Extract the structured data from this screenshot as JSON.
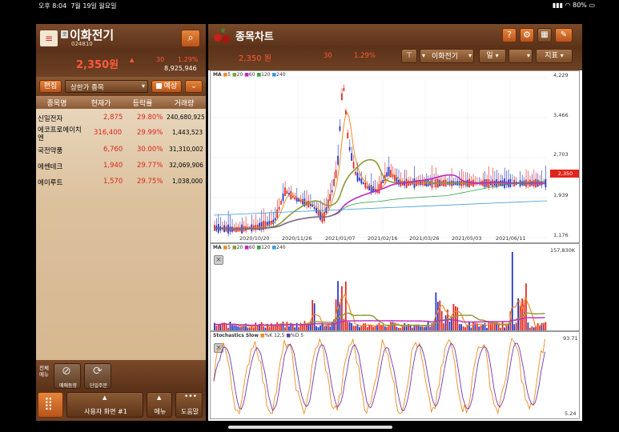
{
  "status": {
    "time": "오후 8:04",
    "date": "7월 19일 월요일",
    "battery": "80%"
  },
  "left": {
    "stock_name": "이화전기",
    "stock_code": "024810",
    "price": "2,350원",
    "change": "30",
    "change_pct": "1.29%",
    "volume": "8,925,946",
    "edit_label": "편집",
    "list_selector": "상한가 종목",
    "predict_label": "예상",
    "columns": [
      "종목명",
      "현재가",
      "등락률",
      "거래량"
    ],
    "rows": [
      {
        "name": "신일전자",
        "price": "2,875",
        "pct": "29.80%",
        "vol": "240,680,925"
      },
      {
        "name": "에코프로에이치엔",
        "price": "316,400",
        "pct": "29.99%",
        "vol": "1,443,523"
      },
      {
        "name": "국전약품",
        "price": "6,760",
        "pct": "30.00%",
        "vol": "31,310,002"
      },
      {
        "name": "에쎈테크",
        "price": "1,940",
        "pct": "29.77%",
        "vol": "32,069,906"
      },
      {
        "name": "에이루트",
        "price": "1,570",
        "pct": "29.75%",
        "vol": "1,038,000"
      }
    ],
    "footer": {
      "menu_toggle": "전체메뉴",
      "trend_btn": "매매동향",
      "order_btn": "단일주문",
      "screen_label": "사용자 화면 #1",
      "menu_label": "메뉴",
      "help_label": "도움말"
    }
  },
  "right": {
    "title": "종목차트",
    "price": "2,350 원",
    "change": "30",
    "change_pct": "1.29%",
    "stock_select": "이화전기",
    "period_select": "일",
    "indicator_label": "지표",
    "price_pane": {
      "legend": [
        "MA",
        "5",
        "20",
        "60",
        "120",
        "240"
      ],
      "y_ticks": [
        "4,229",
        "3,466",
        "2,703",
        "1,939",
        "1,176"
      ],
      "current_tag": "2,350",
      "x_ticks": [
        "2020/10/20",
        "2020/11/26",
        "2021/01/07",
        "2021/02/16",
        "2021/03/26",
        "2021/05/03",
        "2021/06/11"
      ]
    },
    "volume_pane": {
      "legend": [
        "MA",
        "5",
        "20",
        "60",
        "120",
        "240"
      ],
      "y_top": "157,830K"
    },
    "stoch_pane": {
      "legend_title": "Stochastics Slow",
      "legend_k": "%K 12,5",
      "legend_d": "%D 5",
      "y_top": "93.71",
      "y_bottom": "5.24"
    },
    "colors": {
      "ma5": "#f08a24",
      "ma20": "#8a9a3a",
      "ma60": "#c028c0",
      "ma120": "#36a24a",
      "ma240": "#3a9ad8",
      "up": "#e0241b",
      "down": "#2030c0"
    }
  }
}
